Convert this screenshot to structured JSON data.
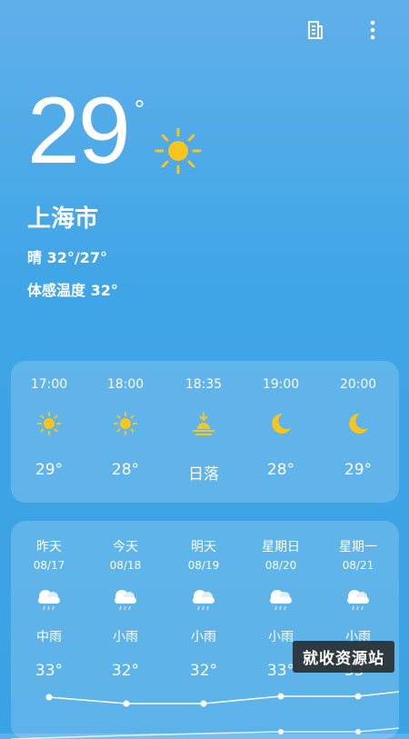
{
  "current": {
    "temperature": "29",
    "degree_symbol": "°",
    "icon": "sun-icon",
    "city": "上海市",
    "condition": "晴  32°/27°",
    "feels_like": "体感温度 32°"
  },
  "hourly": [
    {
      "time": "17:00",
      "icon": "sun-icon",
      "value": "29°"
    },
    {
      "time": "18:00",
      "icon": "sun-icon",
      "value": "28°"
    },
    {
      "time": "18:35",
      "icon": "sunset-icon",
      "value": "日落"
    },
    {
      "time": "19:00",
      "icon": "moon-icon",
      "value": "28°"
    },
    {
      "time": "20:00",
      "icon": "moon-icon",
      "value": "29°"
    }
  ],
  "daily": [
    {
      "day": "昨天",
      "date": "08/17",
      "icon": "cloud-rain-icon",
      "condition": "中雨",
      "high": "33°"
    },
    {
      "day": "今天",
      "date": "08/18",
      "icon": "cloud-rain-icon",
      "condition": "小雨",
      "high": "32°"
    },
    {
      "day": "明天",
      "date": "08/19",
      "icon": "cloud-rain-icon",
      "condition": "小雨",
      "high": "32°"
    },
    {
      "day": "星期日",
      "date": "08/20",
      "icon": "cloud-rain-icon",
      "condition": "小雨",
      "high": "33°"
    },
    {
      "day": "星期一",
      "date": "08/21",
      "icon": "cloud-rain-icon",
      "condition": "小雨",
      "high": "33°"
    }
  ],
  "watermark": "就收资源站",
  "colors": {
    "sun": "#f8c51c",
    "accent_bg": "#3fa5e6"
  }
}
